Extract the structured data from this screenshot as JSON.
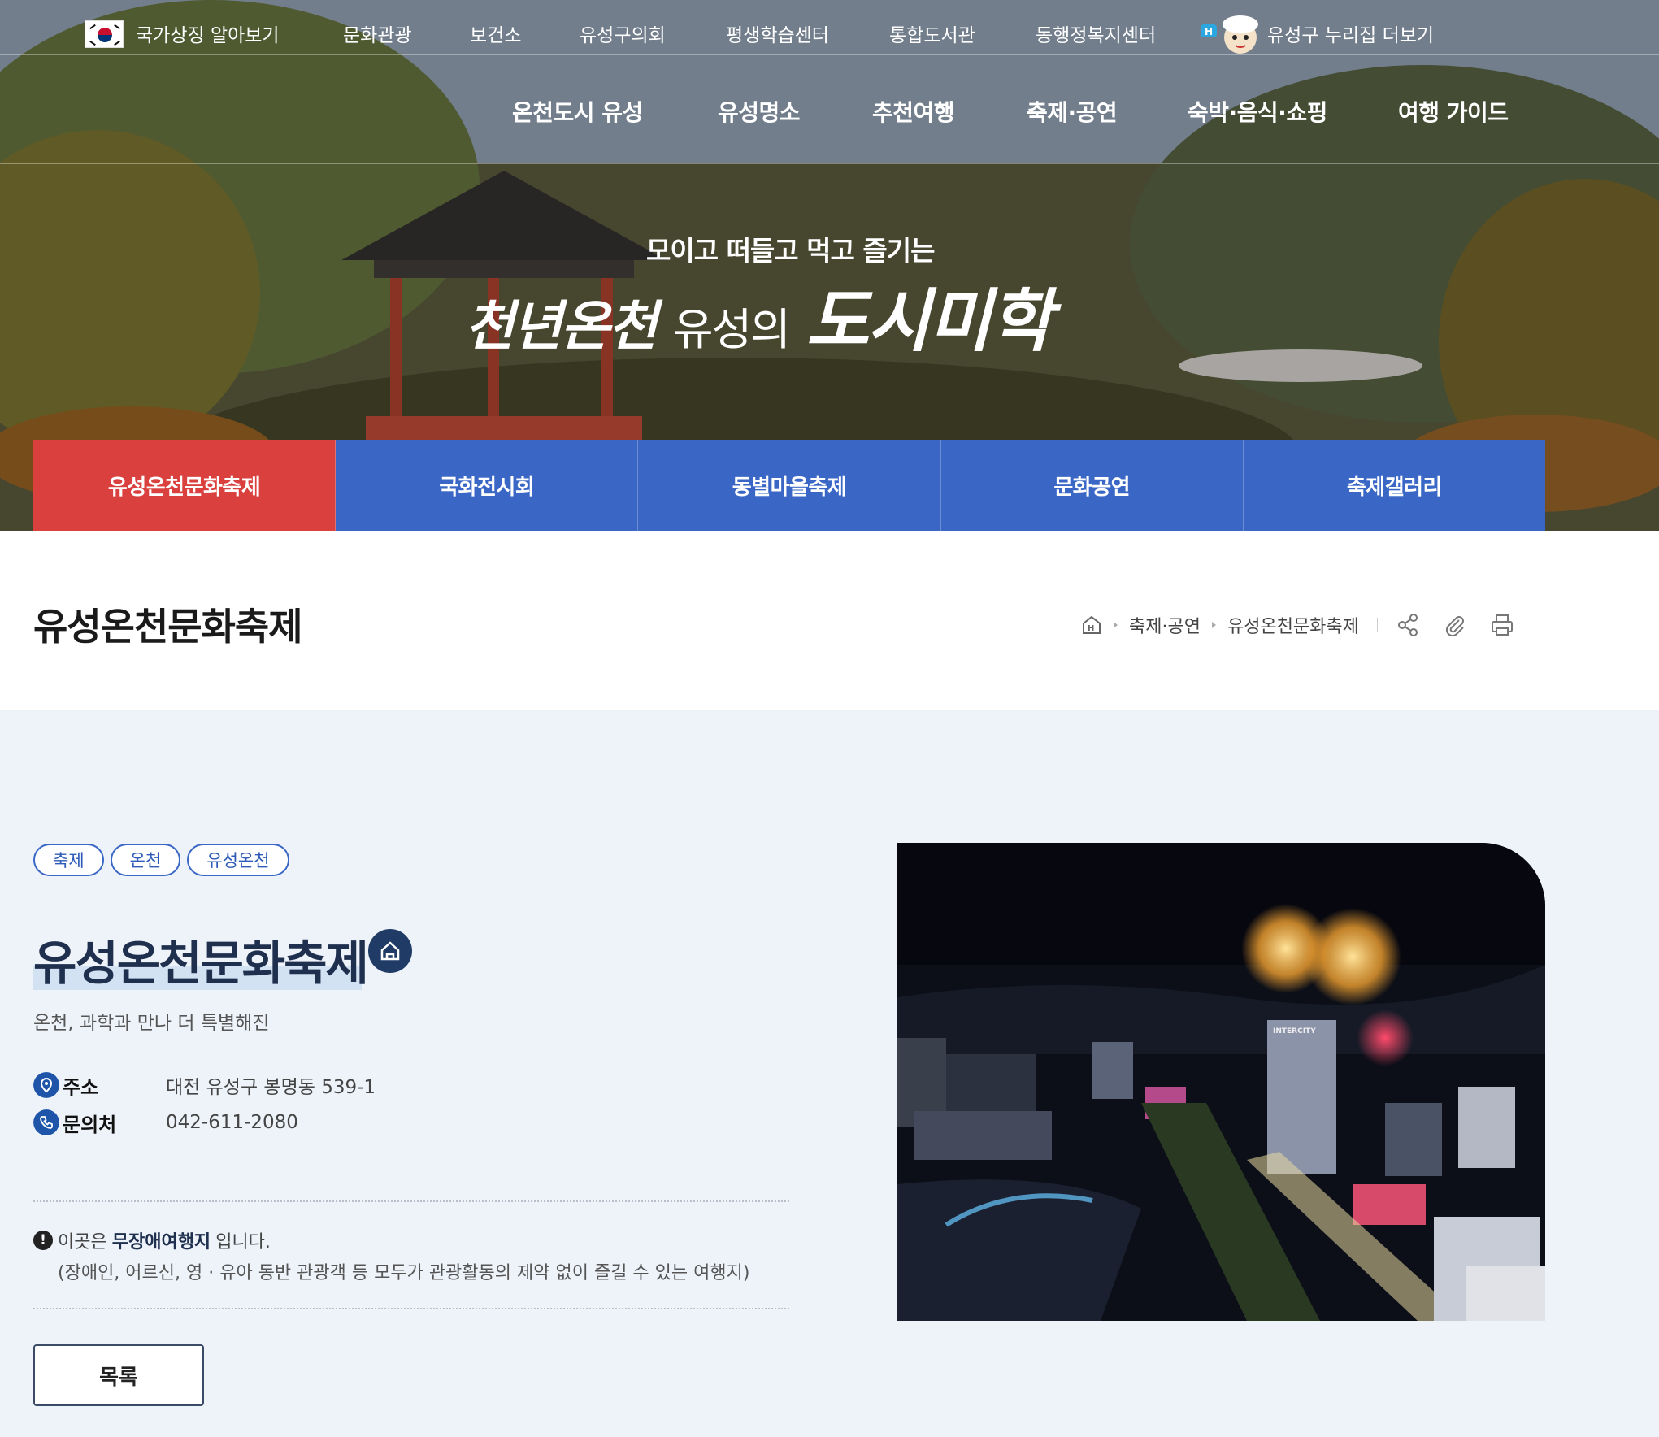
{
  "utility_nav": {
    "items": [
      "국가상징 알아보기",
      "문화관광",
      "보건소",
      "유성구의회",
      "평생학습센터",
      "통합도서관",
      "동행정복지센터",
      "유성구 누리집 더보기"
    ]
  },
  "main_nav": {
    "items": [
      "온천도시 유성",
      "유성명소",
      "추천여행",
      "축제·공연",
      "숙박·음식·쇼핑",
      "여행 가이드"
    ]
  },
  "hero": {
    "slogan_top": "모이고 떠들고 먹고 즐기는",
    "slogan_part1": "천년온천",
    "slogan_part2": "유성의",
    "slogan_part3": "도시미학"
  },
  "sub_tabs": {
    "items": [
      "유성온천문화축제",
      "국화전시회",
      "동별마을축제",
      "문화공연",
      "축제갤러리"
    ],
    "active_index": 0
  },
  "page_header": {
    "title": "유성온천문화축제",
    "breadcrumb": [
      "축제·공연",
      "유성온천문화축제"
    ]
  },
  "detail": {
    "tags": [
      "축제",
      "온천",
      "유성온천"
    ],
    "title": "유성온천문화축제",
    "subtitle": "온천, 과학과 만나 더 특별해진",
    "address_label": "주소",
    "address_value": "대전 유성구 봉명동 539-1",
    "contact_label": "문의처",
    "contact_value": "042-611-2080",
    "notice_prefix": "이곳은",
    "notice_strong": "무장애여행지",
    "notice_suffix": "입니다.",
    "notice_detail": "(장애인, 어르신, 영 · 유아 동반 관광객 등 모두가 관광활동의 제약 없이 즐길 수 있는 여행지)",
    "list_button": "목록",
    "photo_sign": "INTERCITY"
  },
  "colors": {
    "tab_blue": "#3a67c6",
    "tab_active_red": "#d9403e",
    "content_bg": "#eef3fa",
    "title_navy": "#1f2f4e",
    "icon_blue": "#1f55a8"
  }
}
